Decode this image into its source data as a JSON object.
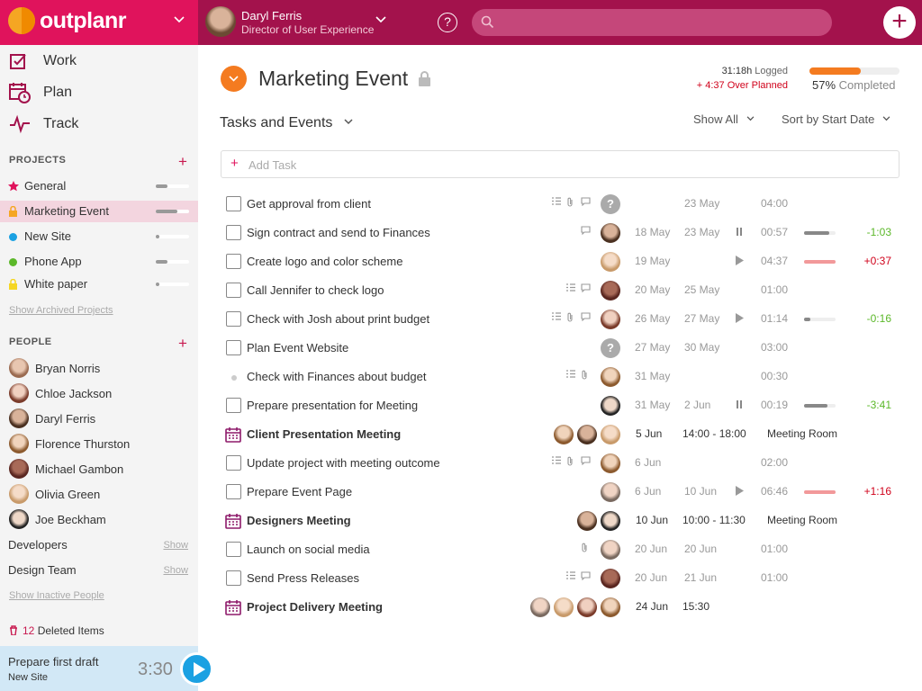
{
  "brand": {
    "name": "outplanr"
  },
  "user": {
    "name": "Daryl Ferris",
    "role": "Director of User Experience"
  },
  "nav": [
    {
      "label": "Work",
      "icon": "checkbox-edit-icon"
    },
    {
      "label": "Plan",
      "icon": "calendar-clock-icon"
    },
    {
      "label": "Track",
      "icon": "pulse-icon"
    }
  ],
  "projects_section": {
    "title": "PROJECTS",
    "show_archived": "Show Archived Projects"
  },
  "projects": [
    {
      "name": "General",
      "color": "#e0135c",
      "shape": "star",
      "progress": 0.35
    },
    {
      "name": "Marketing Event",
      "color": "#f5a623",
      "shape": "lock",
      "progress": 0.65
    },
    {
      "name": "New Site",
      "color": "#1ba1e2",
      "shape": "dot",
      "progress": 0.1
    },
    {
      "name": "Phone App",
      "color": "#5cb82a",
      "shape": "dot",
      "progress": 0.35
    },
    {
      "name": "White paper",
      "color": "#f5d623",
      "shape": "lock",
      "progress": 0.1
    }
  ],
  "people_section": {
    "title": "PEOPLE",
    "show_inactive": "Show Inactive People"
  },
  "people": [
    "Bryan Norris",
    "Chloe Jackson",
    "Daryl Ferris",
    "Florence Thurston",
    "Michael Gambon",
    "Olivia Green",
    "Joe Beckham"
  ],
  "groups": [
    {
      "name": "Developers",
      "action": "Show"
    },
    {
      "name": "Design Team",
      "action": "Show"
    }
  ],
  "deleted": {
    "count": "12",
    "label": "Deleted Items"
  },
  "timer": {
    "task": "Prepare first draft",
    "project": "New Site",
    "time": "3:30"
  },
  "header": {
    "title": "Marketing Event",
    "logged_value": "31:18h",
    "logged_label": "Logged",
    "over_value": "+ 4:37",
    "over_label": "Over Planned",
    "completed_pct": 57,
    "completed_value": "57%",
    "completed_label": "Completed"
  },
  "list": {
    "title": "Tasks and Events",
    "filter": "Show All",
    "sort": "Sort by Start Date",
    "add_placeholder": "Add Task"
  },
  "rows": [
    {
      "kind": "task",
      "title": "Get approval from client",
      "icons": [
        "list",
        "clip",
        "chat"
      ],
      "avatars": [
        "?"
      ],
      "d1": "",
      "d2": "23 May",
      "ctl": "",
      "time": "04:00",
      "bar": null,
      "diff": ""
    },
    {
      "kind": "task",
      "title": "Sign contract and send to Finances",
      "icons": [
        "chat"
      ],
      "avatars": [
        "p3"
      ],
      "d1": "18 May",
      "d2": "23 May",
      "ctl": "pause",
      "time": "00:57",
      "bar": {
        "pct": 0.8,
        "color": "#888"
      },
      "diff": "-1:03"
    },
    {
      "kind": "task",
      "title": "Create logo and color scheme",
      "icons": [],
      "avatars": [
        "p6"
      ],
      "d1": "19 May",
      "d2": "",
      "ctl": "play",
      "time": "04:37",
      "bar": {
        "pct": 1,
        "color": "#f2999a"
      },
      "diff": "+0:37"
    },
    {
      "kind": "task",
      "title": "Call Jennifer to check logo",
      "icons": [
        "list",
        "chat"
      ],
      "avatars": [
        "p5"
      ],
      "d1": "20 May",
      "d2": "25 May",
      "ctl": "",
      "time": "01:00",
      "bar": null,
      "diff": ""
    },
    {
      "kind": "task",
      "title": "Check with Josh about print budget",
      "icons": [
        "list",
        "clip",
        "chat"
      ],
      "avatars": [
        "p2"
      ],
      "d1": "26 May",
      "d2": "27 May",
      "ctl": "play",
      "time": "01:14",
      "bar": {
        "pct": 0.2,
        "color": "#888"
      },
      "diff": "-0:16"
    },
    {
      "kind": "task",
      "title": "Plan Event Website",
      "icons": [],
      "avatars": [
        "?"
      ],
      "d1": "27 May",
      "d2": "30 May",
      "ctl": "",
      "time": "03:00",
      "bar": null,
      "diff": ""
    },
    {
      "kind": "subtask",
      "title": "Check with Finances about budget",
      "icons": [
        "list",
        "clip"
      ],
      "avatars": [
        "p4"
      ],
      "d1": "31 May",
      "d2": "",
      "ctl": "",
      "time": "00:30",
      "bar": null,
      "diff": ""
    },
    {
      "kind": "task",
      "title": "Prepare presentation for Meeting",
      "icons": [],
      "avatars": [
        "p7"
      ],
      "d1": "31 May",
      "d2": "2 Jun",
      "ctl": "pause",
      "time": "00:19",
      "bar": {
        "pct": 0.75,
        "color": "#888"
      },
      "diff": "-3:41"
    },
    {
      "kind": "event",
      "title": "Client Presentation Meeting",
      "avatars": [
        "p4",
        "p3",
        "p6"
      ],
      "date": "5 Jun",
      "time": "14:00 - 18:00",
      "room": "Meeting Room"
    },
    {
      "kind": "task",
      "title": "Update project with meeting outcome",
      "icons": [
        "list",
        "clip",
        "chat"
      ],
      "avatars": [
        "p4"
      ],
      "d1": "6 Jun",
      "d2": "",
      "ctl": "",
      "time": "02:00",
      "bar": null,
      "diff": ""
    },
    {
      "kind": "task",
      "title": "Prepare Event Page",
      "icons": [],
      "avatars": [
        "p1"
      ],
      "d1": "6 Jun",
      "d2": "10 Jun",
      "ctl": "play",
      "time": "06:46",
      "bar": {
        "pct": 1,
        "color": "#f2999a"
      },
      "diff": "+1:16"
    },
    {
      "kind": "event",
      "title": "Designers Meeting",
      "avatars": [
        "p3",
        "p7"
      ],
      "date": "10 Jun",
      "time": "10:00 - 11:30",
      "room": "Meeting Room"
    },
    {
      "kind": "task",
      "title": "Launch on social media",
      "icons": [
        "clip"
      ],
      "avatars": [
        "p1"
      ],
      "d1": "20 Jun",
      "d2": "20 Jun",
      "ctl": "",
      "time": "01:00",
      "bar": null,
      "diff": ""
    },
    {
      "kind": "task",
      "title": "Send Press Releases",
      "icons": [
        "list",
        "chat"
      ],
      "avatars": [
        "p5"
      ],
      "d1": "20 Jun",
      "d2": "21 Jun",
      "ctl": "",
      "time": "01:00",
      "bar": null,
      "diff": ""
    },
    {
      "kind": "event",
      "title": "Project Delivery Meeting",
      "avatars": [
        "p1",
        "p6",
        "p2",
        "p4"
      ],
      "date": "24 Jun",
      "time": "15:30",
      "room": ""
    }
  ],
  "colors": {
    "brand": "#e0135c",
    "topbar": "#a3124c",
    "accent": "#f47b20",
    "positive": "#5cb82a",
    "negative": "#d0021b",
    "timer_bg": "#d2e8f6",
    "play": "#1ba1e2"
  }
}
